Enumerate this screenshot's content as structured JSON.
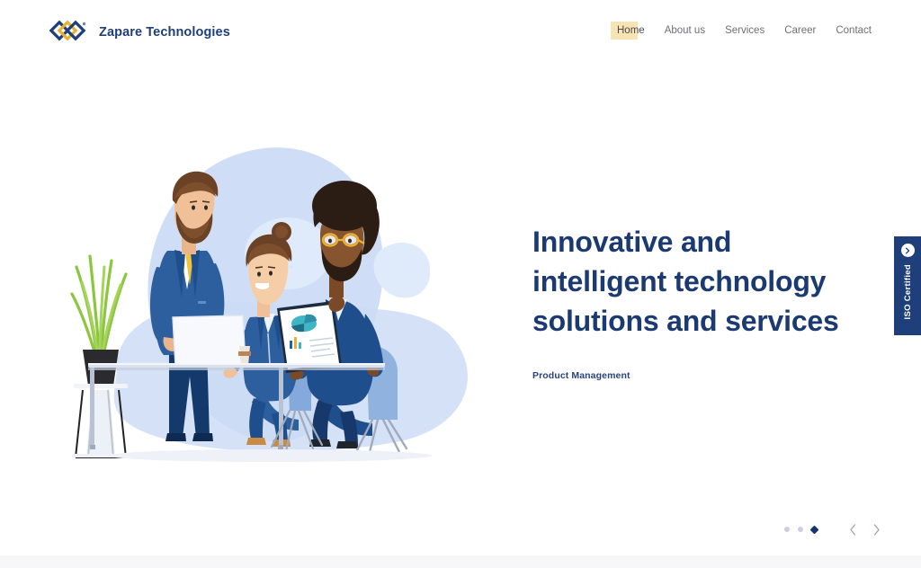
{
  "brand": {
    "name": "Zapare Technologies",
    "logo_icon": "diamonds-logo-icon",
    "trademark": "®",
    "colors": {
      "navy": "#1f3f78",
      "gold": "#e8b133"
    }
  },
  "nav": {
    "items": [
      {
        "label": "Home",
        "active": true,
        "highlight_color": "#f7e4b4"
      },
      {
        "label": "About us",
        "active": false
      },
      {
        "label": "Services",
        "active": false
      },
      {
        "label": "Career",
        "active": false
      },
      {
        "label": "Contact",
        "active": false
      }
    ]
  },
  "hero": {
    "headline_line1": "Innovative and",
    "headline_line2": "intelligent technology",
    "headline_line3": "solutions and services",
    "subhead": "Product Management",
    "headline_color": "#1b3a72",
    "illustration": {
      "name": "business-team-meeting-illustration",
      "blob_color": "#ccdcf5",
      "people": [
        "standing-bearded-man",
        "seated-woman-with-bun",
        "seated-man-with-afro"
      ],
      "objects": [
        "potted-grass-plant",
        "glass-table",
        "chart-document",
        "coffee-cup",
        "blue-chairs"
      ]
    }
  },
  "iso_tab": {
    "label": "ISO Certified",
    "button_icon": "chevron-right-icon",
    "background_color": "#1f3f7a"
  },
  "carousel": {
    "dots": [
      {
        "active": false
      },
      {
        "active": false
      },
      {
        "active": true
      }
    ],
    "prev_icon": "chevron-left-icon",
    "next_icon": "chevron-right-icon",
    "active_color": "#17346b",
    "inactive_color": "#c9cfe0"
  }
}
